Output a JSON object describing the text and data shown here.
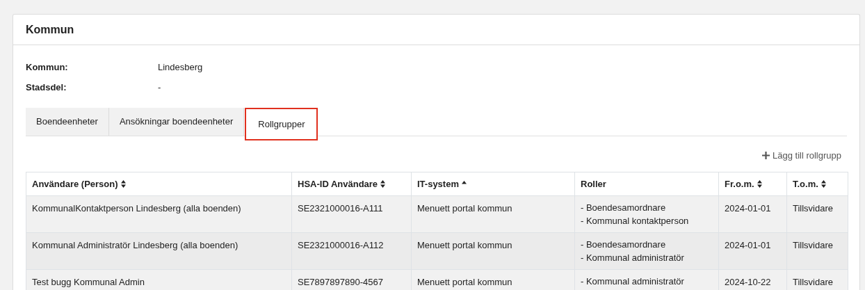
{
  "card": {
    "title": "Kommun"
  },
  "fields": [
    {
      "label": "Kommun:",
      "value": "Lindesberg"
    },
    {
      "label": "Stadsdel:",
      "value": "-"
    }
  ],
  "tabs": [
    {
      "label": "Boendeenheter",
      "selected": false
    },
    {
      "label": "Ansökningar boendeenheter",
      "selected": false
    },
    {
      "label": "Rollgrupper",
      "selected": true
    }
  ],
  "add_button": {
    "label": "Lägg till rollgrupp"
  },
  "table": {
    "columns": [
      {
        "label": "Användare (Person)",
        "sortable": true,
        "sorted_ascending": false
      },
      {
        "label": "HSA-ID Användare",
        "sortable": true,
        "sorted_ascending": false
      },
      {
        "label": "IT-system",
        "sortable": true,
        "sorted_ascending": true
      },
      {
        "label": "Roller",
        "sortable": false,
        "sorted_ascending": false
      },
      {
        "label": "Fr.o.m.",
        "sortable": true,
        "sorted_ascending": false
      },
      {
        "label": "T.o.m.",
        "sortable": true,
        "sorted_ascending": false
      }
    ],
    "rows": [
      {
        "user": "KommunalKontaktperson Lindesberg (alla boenden)",
        "hsa_id": "SE2321000016-A111",
        "it_system": "Menuett portal kommun",
        "roles": [
          "- Boendesamordnare",
          "- Kommunal kontaktperson"
        ],
        "from": "2024-01-01",
        "to": "Tillsvidare"
      },
      {
        "user": "Kommunal Administratör Lindesberg (alla boenden)",
        "hsa_id": "SE2321000016-A112",
        "it_system": "Menuett portal kommun",
        "roles": [
          "- Boendesamordnare",
          "- Kommunal administratör"
        ],
        "from": "2024-01-01",
        "to": "Tillsvidare"
      },
      {
        "user": "Test bugg Kommunal Admin",
        "hsa_id": "SE7897897890-4567",
        "it_system": "Menuett portal kommun",
        "roles": [
          "- Kommunal administratör"
        ],
        "from": "2024-10-22",
        "to": "Tillsvidare"
      }
    ]
  }
}
